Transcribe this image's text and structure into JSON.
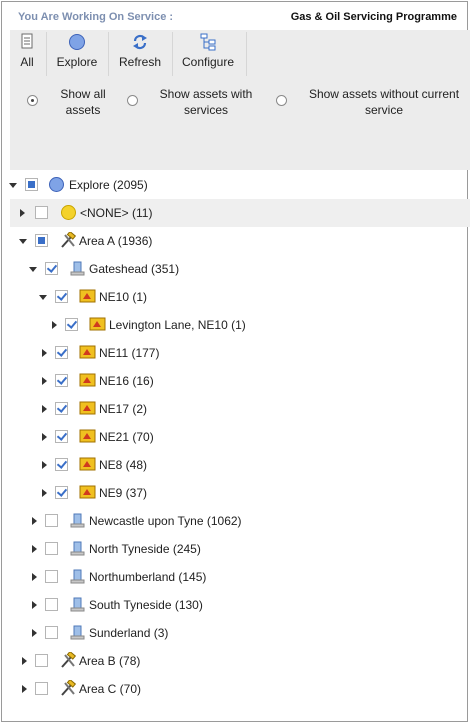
{
  "header": {
    "label": "You Are Working On Service :",
    "service": "Gas & Oil Servicing Programme"
  },
  "toolbar": {
    "all_label": "All",
    "explore_label": "Explore",
    "refresh_label": "Refresh",
    "configure_label": "Configure"
  },
  "options": {
    "show_all": "Show all assets",
    "show_with": "Show assets with services",
    "show_without": "Show assets without current service",
    "selected": "show_all"
  },
  "tree": {
    "explore": "Explore (2095)",
    "none": "<NONE> (11)",
    "area_a": "Area A (1936)",
    "gateshead": "Gateshead (351)",
    "ne10": "NE10 (1)",
    "levington": "Levington Lane, NE10 (1)",
    "ne11": "NE11 (177)",
    "ne16": "NE16 (16)",
    "ne17": "NE17 (2)",
    "ne21": "NE21 (70)",
    "ne8": "NE8 (48)",
    "ne9": "NE9 (37)",
    "newcastle": "Newcastle upon Tyne (1062)",
    "north_tyneside": "North Tyneside (245)",
    "northumberland": "Northumberland (145)",
    "south_tyneside": "South Tyneside (130)",
    "sunderland": "Sunderland (3)",
    "area_b": "Area B (78)",
    "area_c": "Area C (70)"
  }
}
